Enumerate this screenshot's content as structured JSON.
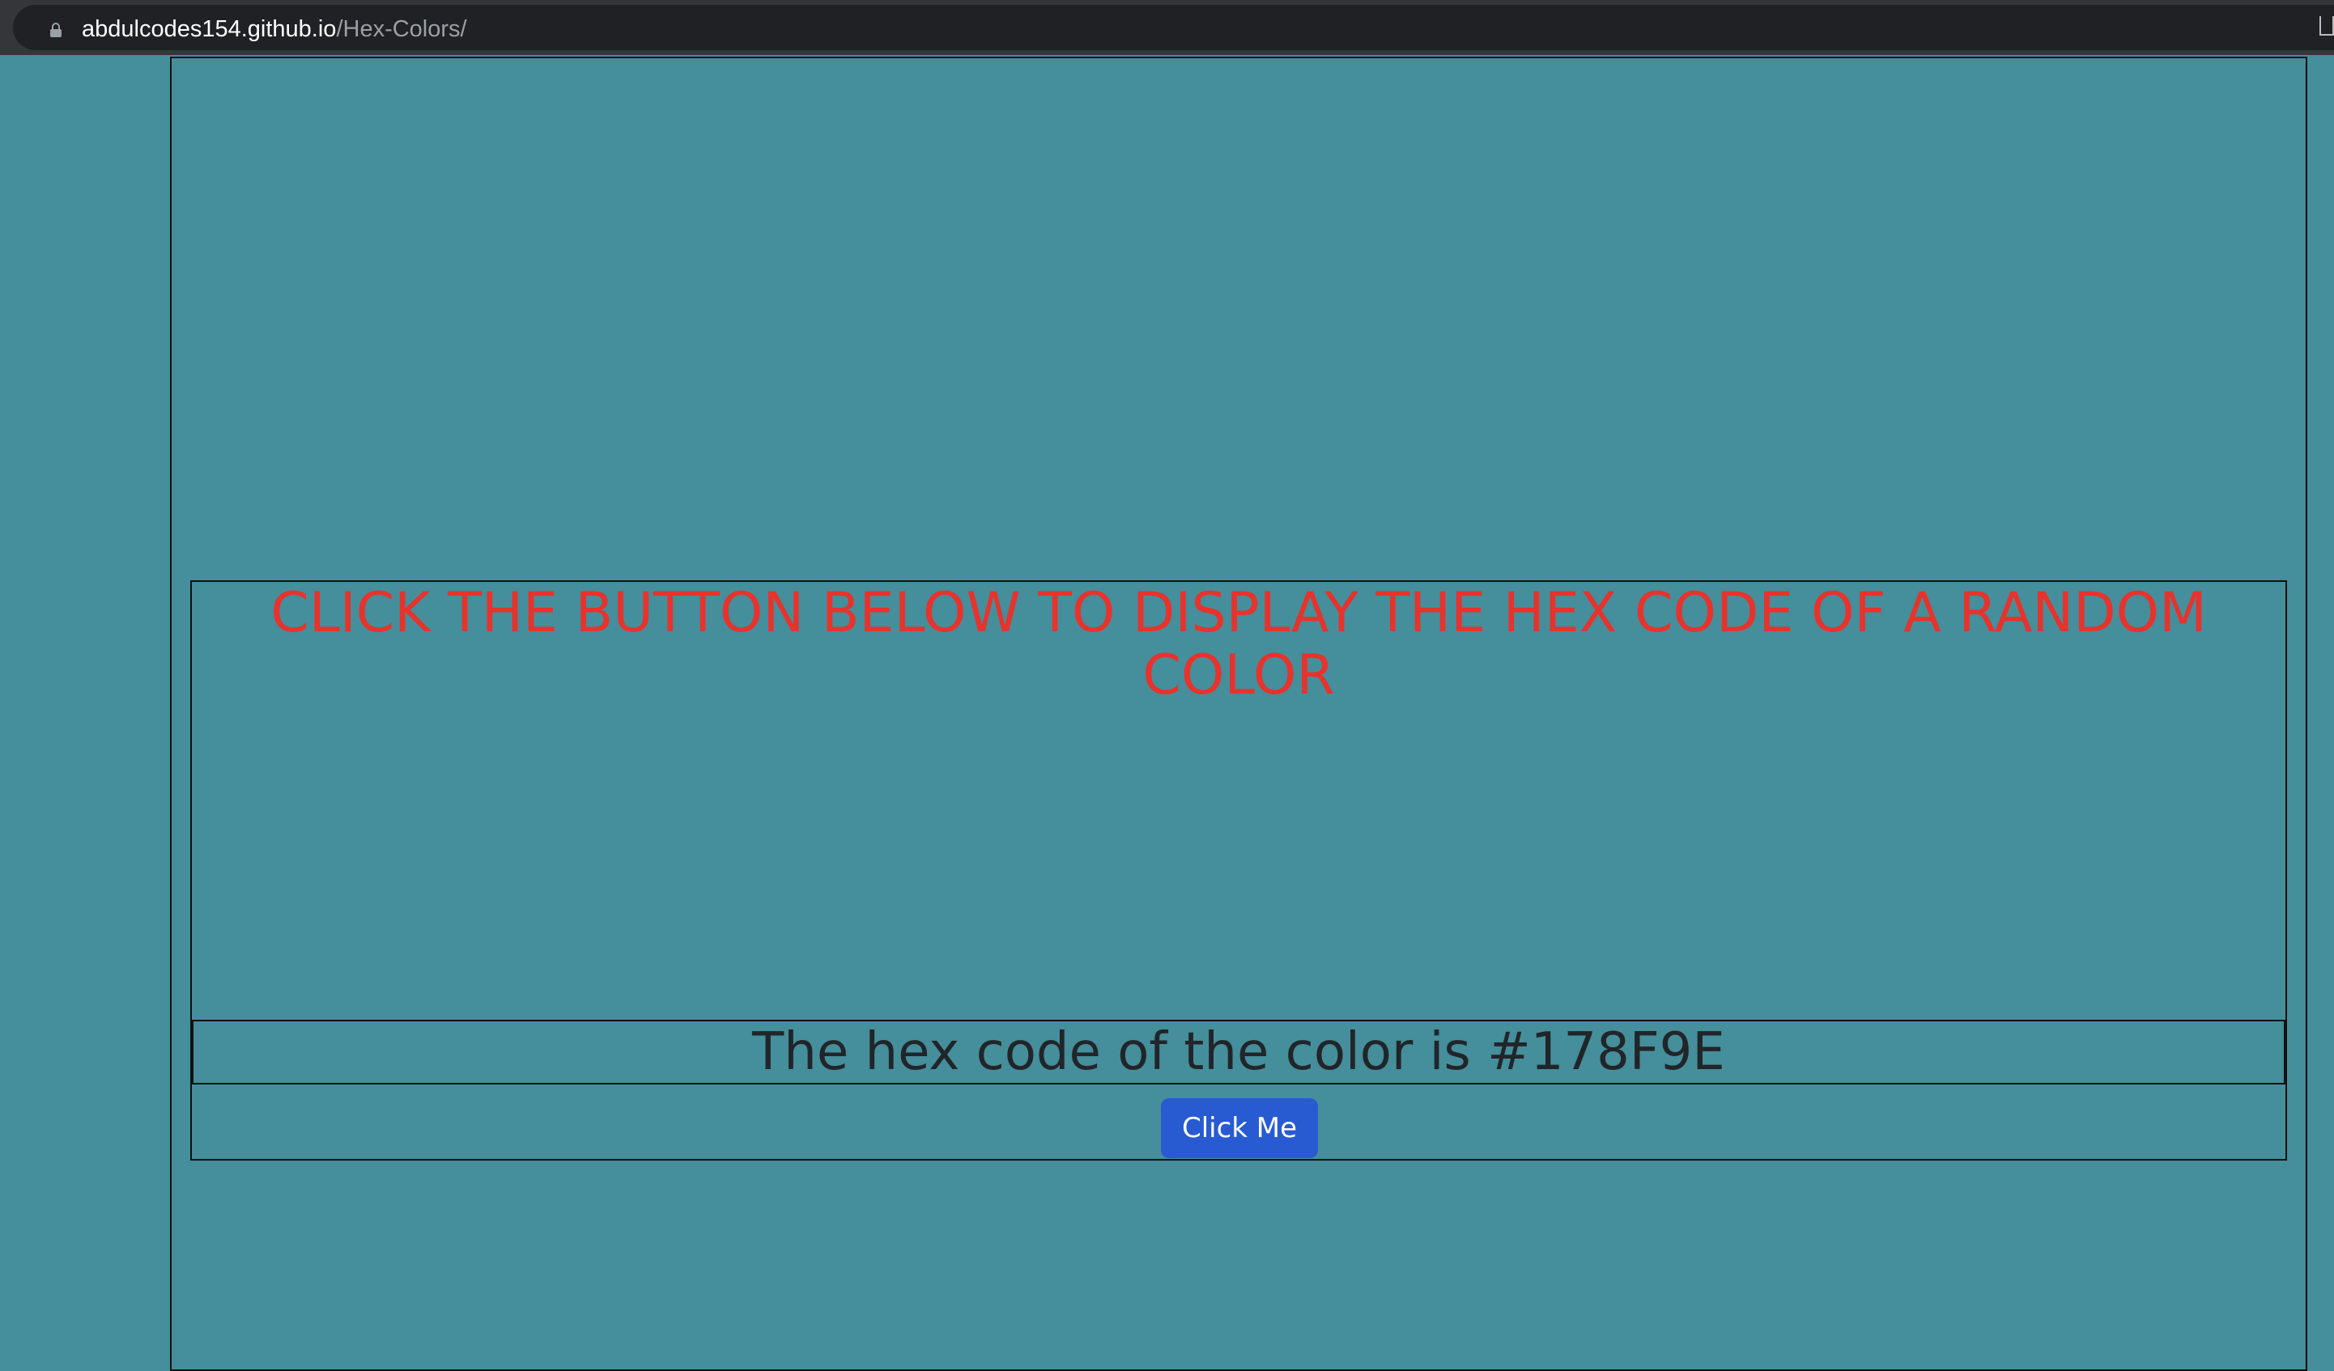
{
  "browser": {
    "url_host": "abdulcodes154.github.io",
    "url_path": "/Hex-Colors/"
  },
  "page": {
    "heading": "CLICK THE BUTTON BELOW TO DISPLAY THE HEX CODE OF A RANDOM COLOR",
    "hex_text": "The hex code of the color is #178F9E",
    "button_label": "Click Me",
    "background_color": "#458E9B"
  }
}
